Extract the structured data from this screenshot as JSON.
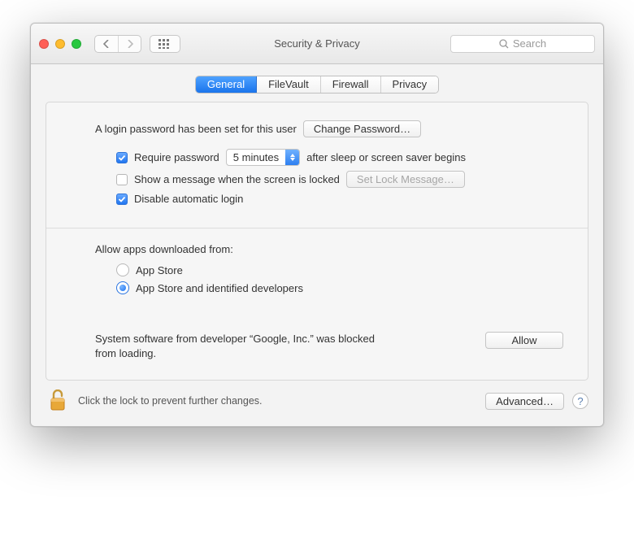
{
  "window": {
    "title": "Security & Privacy"
  },
  "search": {
    "placeholder": "Search"
  },
  "tabs": {
    "general": "General",
    "filevault": "FileVault",
    "firewall": "Firewall",
    "privacy": "Privacy",
    "active": "general"
  },
  "login": {
    "desc": "A login password has been set for this user",
    "change_btn": "Change Password…",
    "require_pw_label_pre": "Require password",
    "require_pw_label_post": "after sleep or screen saver begins",
    "require_pw_checked": true,
    "require_pw_interval": "5 minutes",
    "show_msg_label": "Show a message when the screen is locked",
    "show_msg_checked": false,
    "set_lock_btn": "Set Lock Message…",
    "disable_auto_login_label": "Disable automatic login",
    "disable_auto_login_checked": true
  },
  "downloads": {
    "section_label": "Allow apps downloaded from:",
    "opts": [
      "App Store",
      "App Store and identified developers"
    ],
    "selected": 1
  },
  "blocked": {
    "message": "System software from developer “Google, Inc.” was blocked from loading.",
    "allow_btn": "Allow"
  },
  "footer": {
    "lock_text": "Click the lock to prevent further changes.",
    "advanced_btn": "Advanced…",
    "help": "?"
  }
}
